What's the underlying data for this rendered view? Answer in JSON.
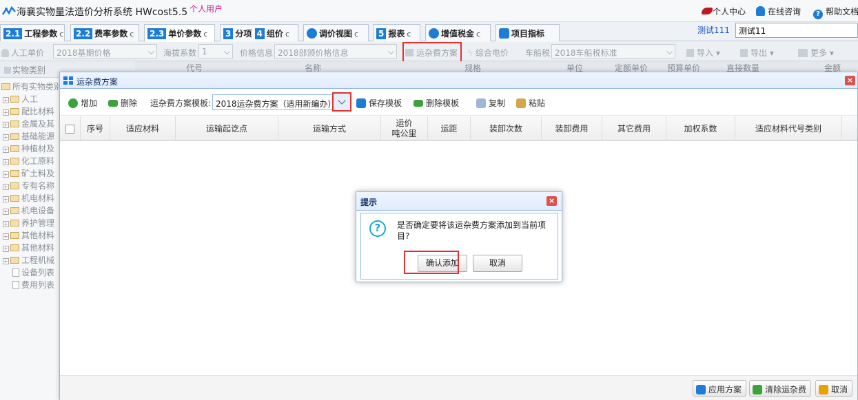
{
  "app": {
    "title": "海襄实物量法造价分析系统 HWcost5.5",
    "user_type": "个人用户"
  },
  "top_links": {
    "profile": "个人中心",
    "online": "在线咨询",
    "help": "帮助文档"
  },
  "tabs": [
    {
      "num": "2.1",
      "label": "工程参数"
    },
    {
      "num": "2.2",
      "label": "费率参数"
    },
    {
      "num": "2.3",
      "label": "单价参数"
    },
    {
      "num": "3",
      "label": "分项"
    },
    {
      "num": "4",
      "label": "组价"
    },
    {
      "label": "调价视图"
    },
    {
      "num": "5",
      "label": "报表"
    },
    {
      "label": "增值税金"
    },
    {
      "label": "项目指标"
    }
  ],
  "tab_refresh": "c",
  "project": {
    "name": "测试111",
    "input_value": "测试11"
  },
  "toolbar": {
    "labor_price": "人工单价",
    "labor_price_value": "2018基期价格",
    "altitude": "海拔系数",
    "altitude_value": "1",
    "price_info": "价格信息",
    "price_info_value": "2018部颁价格信息",
    "freight_scheme": "运杂费方案",
    "composite_price": "综合电价",
    "vehicle_tax": "车船税",
    "vehicle_tax_value": "2018车船税标准",
    "import": "导入",
    "export": "导出",
    "more": "更多"
  },
  "tree": {
    "header": "实物类别",
    "root": "所有实物类别",
    "items": [
      "人工",
      "配比材料",
      "金属及其",
      "基础能源",
      "种植材及",
      "化工原料",
      "矿土料及",
      "专有名称",
      "机电材料",
      "机电设备",
      "养护管理",
      "其他材料",
      "其他材料",
      "工程机械"
    ],
    "leaves": [
      "设备列表",
      "费用列表"
    ]
  },
  "bg_grid": {
    "headers": [
      "代号",
      "名称",
      "规格",
      "单位",
      "定额单价",
      "预算单价",
      "直接数量",
      "金额"
    ]
  },
  "freight_dialog": {
    "title": "运杂费方案",
    "add": "增加",
    "delete": "删除",
    "template_label": "运杂费方案模板:",
    "template_value": "2018运杂费方案（适用新编办）",
    "save_template": "保存模板",
    "delete_template": "删除模板",
    "copy": "复制",
    "paste": "粘贴",
    "columns": [
      "序号",
      "适应材料",
      "运输起讫点",
      "运输方式",
      "运价\n吨公里",
      "运距",
      "装卸次数",
      "装卸费用",
      "其它费用",
      "加权系数",
      "适应材料代号类别"
    ],
    "apply": "应用方案",
    "clear": "清除运杂费",
    "cancel": "取消"
  },
  "confirm_dialog": {
    "title": "提示",
    "message": "是否确定要将该运杂费方案添加到当前项目?",
    "confirm": "确认添加",
    "cancel": "取消"
  },
  "colors": {
    "accent": "#1c7cd6",
    "highlight": "#e03030",
    "dialog_border": "#95b8e7",
    "question": "#11a9d6"
  }
}
